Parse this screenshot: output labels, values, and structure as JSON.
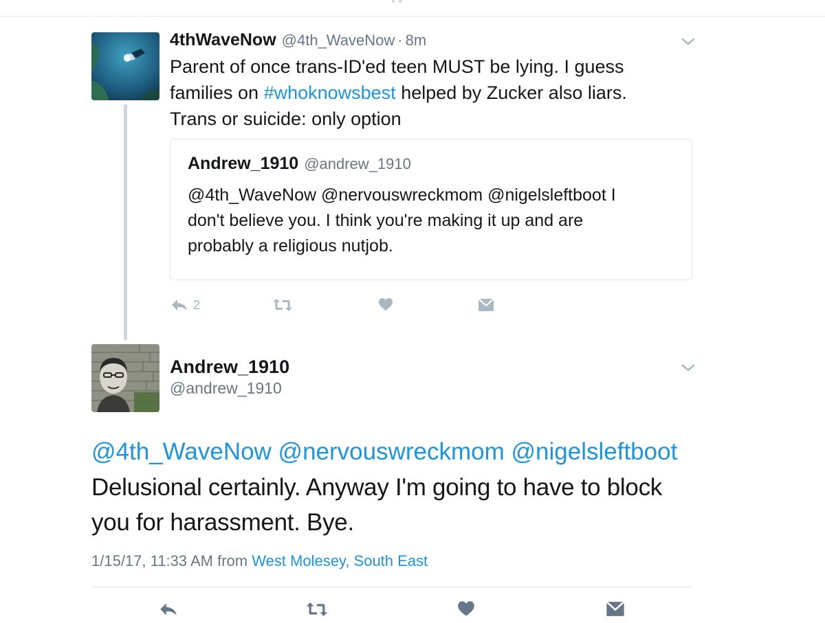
{
  "parent_tweet": {
    "display_name": "4thWaveNow",
    "handle": "@4th_WaveNow",
    "separator": "·",
    "time_ago": "8m",
    "text_line1": "Parent of once trans-ID'ed teen MUST be lying. I guess",
    "text_line2_before": "families on ",
    "hashtag": "#whoknowsbest",
    "text_line2_after": " helped by Zucker also liars.",
    "text_line3": "Trans or suicide: only option",
    "quote": {
      "display_name": "Andrew_1910",
      "handle": "@andrew_1910",
      "line1": "@4th_WaveNow @nervouswreckmom @nigelsleftboot I",
      "line2": "don't believe you. I think you're making it up and are",
      "line3": "probably a religious nutjob."
    },
    "actions": {
      "reply_count": "2"
    }
  },
  "main_tweet": {
    "display_name": "Andrew_1910",
    "handle": "@andrew_1910",
    "mentions": "@4th_WaveNow @nervouswreckmom @nigelsleftboot",
    "text_line1": "Delusional certainly. Anyway I'm going to have to block",
    "text_line2": "you for harassment. Bye.",
    "timestamp": "1/15/17, 11:33 AM",
    "from_label": "from",
    "location": "West Molesey, South East"
  },
  "icons": {
    "reply": "reply-icon",
    "retweet": "retweet-icon",
    "like": "heart-icon",
    "dm": "envelope-icon",
    "more": "chevron-down-icon"
  },
  "colors": {
    "link": "#1b95e0",
    "secondary_text": "#657786",
    "icon_gray": "#aab8c2",
    "divider": "#e1e8ed"
  }
}
